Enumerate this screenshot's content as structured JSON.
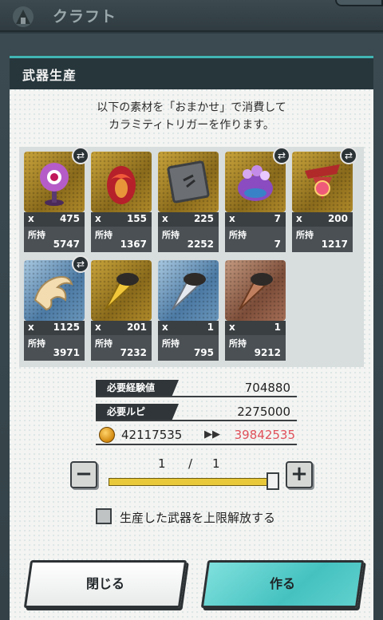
{
  "topbar": {
    "title": "クラフト"
  },
  "dialog": {
    "title": "武器生産",
    "message_line1": "以下の素材を「おまかせ」で消費して",
    "message_line2": "カラミティトリガーを作ります。"
  },
  "items": [
    {
      "x": "x",
      "count": "475",
      "own_label": "所持",
      "own": "5747",
      "frame": "gold",
      "swap": true,
      "icon": "purple-eye-orb-icon"
    },
    {
      "x": "x",
      "count": "155",
      "own_label": "所持",
      "own": "1367",
      "frame": "gold",
      "swap": false,
      "icon": "red-flame-egg-icon"
    },
    {
      "x": "x",
      "count": "225",
      "own_label": "所持",
      "own": "2252",
      "frame": "gold",
      "swap": false,
      "icon": "metal-plate-icon"
    },
    {
      "x": "x",
      "count": "7",
      "own_label": "所持",
      "own": "7",
      "frame": "gold",
      "swap": true,
      "icon": "jewel-pot-icon"
    },
    {
      "x": "x",
      "count": "200",
      "own_label": "所持",
      "own": "1217",
      "frame": "gold",
      "swap": true,
      "icon": "ribbon-gem-icon"
    },
    {
      "x": "x",
      "count": "1125",
      "own_label": "所持",
      "own": "3971",
      "frame": "blue",
      "swap": true,
      "icon": "claw-horn-icon"
    },
    {
      "x": "x",
      "count": "201",
      "own_label": "所持",
      "own": "7232",
      "frame": "gold",
      "swap": false,
      "icon": "gold-blade-icon"
    },
    {
      "x": "x",
      "count": "1",
      "own_label": "所持",
      "own": "795",
      "frame": "blue",
      "swap": false,
      "icon": "silver-blade-icon"
    },
    {
      "x": "x",
      "count": "1",
      "own_label": "所持",
      "own": "9212",
      "frame": "bronze",
      "swap": false,
      "icon": "bronze-blade-icon"
    }
  ],
  "stats": {
    "exp_label": "必要経験値",
    "exp_value": "704880",
    "ruby_label": "必要ルピ",
    "ruby_value": "2275000",
    "ruby_current": "42117535",
    "ruby_arrow": "▶▶",
    "ruby_after": "39842535"
  },
  "quantity": {
    "current": "1",
    "sep": "/",
    "max": "1",
    "minus": "−",
    "plus": "+"
  },
  "option": {
    "label": "生産した武器を上限解放する",
    "checked": false
  },
  "buttons": {
    "close": "閉じる",
    "make": "作る"
  },
  "colors": {
    "accent": "#45c2c0",
    "after_value": "#e0505a",
    "slider": "#e9c93a"
  }
}
